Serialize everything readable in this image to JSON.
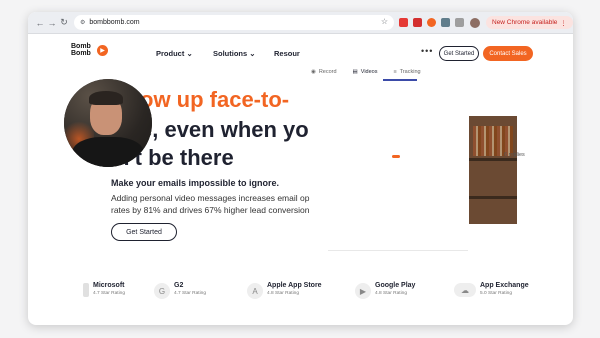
{
  "browser": {
    "url": "bombbomb.com",
    "new_chrome_label": "New Chrome available",
    "icons": [
      "back-icon",
      "forward-icon",
      "reload-icon",
      "star-icon",
      "extensions-icon",
      "more-icon"
    ]
  },
  "site": {
    "logo_text": "Bomb Bomb",
    "nav": [
      {
        "label": "Product"
      },
      {
        "label": "Solutions"
      },
      {
        "label": "Resour"
      }
    ],
    "get_started_top": "Get Started",
    "contact_sales": "Contact Sales"
  },
  "recorder": {
    "tabs": [
      {
        "label": "Record"
      },
      {
        "label": "Videos"
      },
      {
        "label": "Tracking"
      }
    ]
  },
  "hero": {
    "line1": "ow up face-to-",
    "line2": "e, even when yo",
    "line3": "n't be there",
    "subheading": "Make your emails impossible to ignore.",
    "body_line1": "Adding personal video messages increases email op",
    "body_line2": "rates by 81% and drives 67% higher lead conversion",
    "cta": "Get Started"
  },
  "video_card": {
    "replies": "6 replies"
  },
  "ratings": [
    {
      "name": "Microsoft",
      "sub": "4.7 Star Rating",
      "icon": "microsoft-icon"
    },
    {
      "name": "G2",
      "sub": "4.7 Star Rating",
      "icon": "g2-icon"
    },
    {
      "name": "Apple App Store",
      "sub": "4.8 Star Rating",
      "icon": "apple-icon"
    },
    {
      "name": "Google Play",
      "sub": "4.8 Star Rating",
      "icon": "google-play-icon"
    },
    {
      "name": "App Exchange",
      "sub": "5.0 Star Rating",
      "icon": "salesforce-icon"
    }
  ],
  "colors": {
    "brand_orange": "#f26522",
    "navy": "#1f2230",
    "accent_blue": "#3b4ba8"
  }
}
